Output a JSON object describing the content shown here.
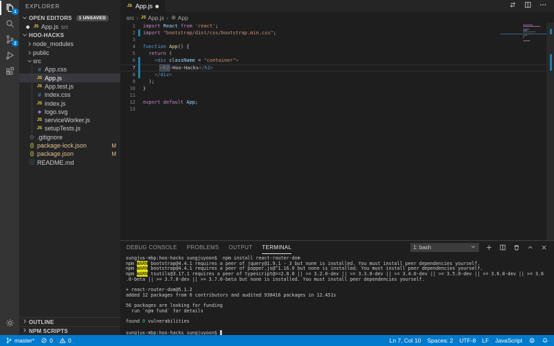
{
  "activity_bar": {
    "items": [
      {
        "name": "explorer",
        "icon": "files-icon",
        "badge": "1",
        "active": true
      },
      {
        "name": "search",
        "icon": "search-icon"
      },
      {
        "name": "source-control",
        "icon": "source-control-icon",
        "badge": "2"
      },
      {
        "name": "run-and-debug",
        "icon": "debug-icon"
      },
      {
        "name": "extensions",
        "icon": "extensions-icon"
      }
    ],
    "bottom_items": [
      {
        "name": "manage",
        "icon": "gear-icon"
      }
    ]
  },
  "sidebar": {
    "title": "EXPLORER",
    "open_editors": {
      "label": "OPEN EDITORS",
      "badge": "1 UNSAVED",
      "items": [
        {
          "label": "App.js",
          "description": "src",
          "icon": "js",
          "dirty": true
        }
      ]
    },
    "project": {
      "label": "HOO-HACKS",
      "items": [
        {
          "kind": "folder",
          "label": "node_modules",
          "level": 1,
          "expanded": false
        },
        {
          "kind": "folder",
          "label": "public",
          "level": 1,
          "expanded": false
        },
        {
          "kind": "folder",
          "label": "src",
          "level": 1,
          "expanded": true
        },
        {
          "kind": "file",
          "label": "App.css",
          "icon": "css",
          "level": 2
        },
        {
          "kind": "file",
          "label": "App.js",
          "icon": "js",
          "level": 2,
          "selected": true
        },
        {
          "kind": "file",
          "label": "App.test.js",
          "icon": "js",
          "level": 2
        },
        {
          "kind": "file",
          "label": "index.css",
          "icon": "css",
          "level": 2
        },
        {
          "kind": "file",
          "label": "index.js",
          "icon": "js",
          "level": 2
        },
        {
          "kind": "file",
          "label": "logo.svg",
          "icon": "svg",
          "level": 2
        },
        {
          "kind": "file",
          "label": "serviceWorker.js",
          "icon": "js",
          "level": 2
        },
        {
          "kind": "file",
          "label": "setupTests.js",
          "icon": "js",
          "level": 2
        },
        {
          "kind": "file",
          "label": ".gitignore",
          "icon": "git",
          "level": 1
        },
        {
          "kind": "file",
          "label": "package-lock.json",
          "icon": "json",
          "level": 1,
          "git_status": "M",
          "modified": true
        },
        {
          "kind": "file",
          "label": "package.json",
          "icon": "json",
          "level": 1,
          "git_status": "M",
          "modified": true
        },
        {
          "kind": "file",
          "label": "README.md",
          "icon": "md",
          "level": 1
        }
      ]
    },
    "bottom_sections": [
      {
        "label": "OUTLINE"
      },
      {
        "label": "NPM SCRIPTS"
      }
    ]
  },
  "editor": {
    "tab": {
      "label": "App.js",
      "icon": "js",
      "dirty": true
    },
    "breadcrumb": [
      {
        "label": "src"
      },
      {
        "label": "App.js",
        "icon": "js"
      },
      {
        "label": "App",
        "icon": "symbol"
      }
    ],
    "current_line": 7,
    "cursor": {
      "line": 7,
      "col": 10
    },
    "modified_lines": [
      2,
      6,
      7,
      8
    ],
    "lines": [
      [
        {
          "t": "import",
          "c": "kw"
        },
        {
          "t": " ",
          "c": "pl"
        },
        {
          "t": "React",
          "c": "var"
        },
        {
          "t": " ",
          "c": "pl"
        },
        {
          "t": "from",
          "c": "kw"
        },
        {
          "t": " ",
          "c": "pl"
        },
        {
          "t": "'react'",
          "c": "str"
        },
        {
          "t": ";",
          "c": "pl"
        }
      ],
      [
        {
          "t": "import",
          "c": "kw"
        },
        {
          "t": " ",
          "c": "pl"
        },
        {
          "t": "\"bootstrap/dist/css/bootstrap.min.css\"",
          "c": "str"
        },
        {
          "t": ";",
          "c": "pl"
        }
      ],
      [],
      [
        {
          "t": "function",
          "c": "kwb"
        },
        {
          "t": " ",
          "c": "pl"
        },
        {
          "t": "App",
          "c": "fn"
        },
        {
          "t": "() {",
          "c": "pl"
        }
      ],
      [
        {
          "t": "  ",
          "c": "pl"
        },
        {
          "t": "return",
          "c": "kw"
        },
        {
          "t": " (",
          "c": "pl"
        }
      ],
      [
        {
          "t": "    ",
          "c": "pl"
        },
        {
          "t": "<",
          "c": "br"
        },
        {
          "t": "div",
          "c": "tag"
        },
        {
          "t": " ",
          "c": "pl"
        },
        {
          "t": "className",
          "c": "var"
        },
        {
          "t": " = ",
          "c": "pl"
        },
        {
          "t": "\"container\"",
          "c": "str"
        },
        {
          "t": ">",
          "c": "br"
        }
      ],
      [
        {
          "t": "      ",
          "c": "pl"
        },
        {
          "g": [
            {
              "t": "<",
              "c": "br"
            },
            {
              "t": "h2",
              "c": "tag"
            }
          ],
          "c": "sel"
        },
        {
          "cursor": true
        },
        {
          "t": ">",
          "c": "br"
        },
        {
          "t": "Hoo-Hacks",
          "c": "txt"
        },
        {
          "t": "</",
          "c": "br"
        },
        {
          "t": "h2",
          "c": "tag"
        },
        {
          "t": ">",
          "c": "br"
        }
      ],
      [
        {
          "t": "    ",
          "c": "pl"
        },
        {
          "t": "</",
          "c": "br"
        },
        {
          "t": "div",
          "c": "tag"
        },
        {
          "t": ">",
          "c": "br"
        }
      ],
      [
        {
          "t": "  );",
          "c": "pl"
        }
      ],
      [
        {
          "t": "}",
          "c": "pl"
        }
      ],
      [],
      [
        {
          "t": "export",
          "c": "kw"
        },
        {
          "t": " ",
          "c": "pl"
        },
        {
          "t": "default",
          "c": "kw"
        },
        {
          "t": " ",
          "c": "pl"
        },
        {
          "t": "App",
          "c": "var"
        },
        {
          "t": ";",
          "c": "pl"
        }
      ],
      []
    ]
  },
  "panel": {
    "tabs": [
      {
        "label": "DEBUG CONSOLE"
      },
      {
        "label": "PROBLEMS"
      },
      {
        "label": "OUTPUT"
      },
      {
        "label": "TERMINAL",
        "active": true
      }
    ],
    "shell_select": {
      "value": "1: bash"
    },
    "terminal_lines": [
      [
        {
          "t": "sungjus-mbp:hoo-hacks sungjuyoon$  npm install react-router-dom",
          "c": "pl"
        }
      ],
      [
        {
          "t": "npm ",
          "c": "pl"
        },
        {
          "t": "WARN",
          "c": "warn"
        },
        {
          "t": " bootstrap@4.4.1 requires a peer of jquery@1.9.1 - 3 but none is installed. You must install peer dependencies yourself.",
          "c": "pl"
        }
      ],
      [
        {
          "t": "npm ",
          "c": "pl"
        },
        {
          "t": "WARN",
          "c": "warn"
        },
        {
          "t": " bootstrap@4.4.1 requires a peer of popper.js@^1.16.0 but none is installed. You must install peer dependencies yourself.",
          "c": "pl"
        }
      ],
      [
        {
          "t": "npm ",
          "c": "pl"
        },
        {
          "t": "WARN",
          "c": "warn"
        },
        {
          "t": " tsutils@3.17.1 requires a peer of typescript@>=2.8.0 || >= 3.2.0-dev || >= 3.3.0-dev || >= 3.4.0-dev || >= 3.5.0-dev || >= 3.6.0-dev || >= 3.6",
          "c": "pl"
        }
      ],
      [
        {
          "t": ".0-beta || >= 3.7.0-dev || >= 3.7.0-beta but none is installed. You must install peer dependencies yourself.",
          "c": "pl"
        }
      ],
      [],
      [
        {
          "t": "+ react-router-dom@5.1.2",
          "c": "pl"
        }
      ],
      [
        {
          "t": "added 12 packages from 6 contributors and audited 930416 packages in 12.451s",
          "c": "pl"
        }
      ],
      [],
      [
        {
          "t": "56 packages are looking for funding",
          "c": "pl"
        }
      ],
      [
        {
          "t": "  run `npm fund` for details",
          "c": "pl"
        }
      ],
      [],
      [
        {
          "t": "found ",
          "c": "pl"
        },
        {
          "t": "0",
          "c": "grn"
        },
        {
          "t": " vulnerabilities",
          "c": "pl"
        }
      ],
      [],
      [
        {
          "t": "sungjus-mbp:hoo-hacks sungjuyoon$ ",
          "c": "pl"
        },
        {
          "cursor": true
        }
      ]
    ]
  },
  "status_bar": {
    "left": [
      {
        "icon": "branch-icon",
        "label": "master*",
        "name": "git-branch"
      },
      {
        "icon": "error-icon",
        "label": "0",
        "name": "errors"
      },
      {
        "icon": "warning-icon",
        "label": "0",
        "name": "warnings"
      }
    ],
    "right": [
      {
        "label": "Ln 7, Col 10",
        "name": "cursor-position"
      },
      {
        "label": "Spaces: 2",
        "name": "indentation"
      },
      {
        "label": "UTF-8",
        "name": "encoding"
      },
      {
        "label": "LF",
        "name": "eol"
      },
      {
        "label": "JavaScript",
        "name": "language-mode"
      },
      {
        "icon": "feedback-icon",
        "name": "feedback"
      },
      {
        "icon": "bell-icon",
        "name": "notifications"
      }
    ]
  },
  "colors": {
    "status_bar": "#007acc",
    "accent_badge": "#007acc",
    "warn_badge": "#e5e510",
    "git_modified": "#e2c08d",
    "gutter_modified": "#1b81a8"
  }
}
